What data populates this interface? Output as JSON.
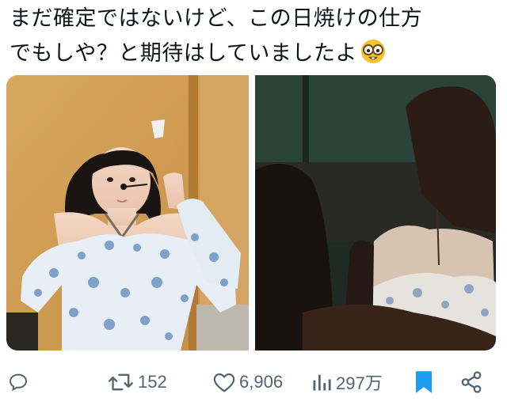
{
  "tweet": {
    "line1": "まだ確定ではないけど、この日焼けの仕方",
    "line2": "でもしや？と期待はしていましたよ",
    "emoji": "nerd-face-emoji"
  },
  "media": {
    "left_photo": "woman-in-blue-floral-dress-photo",
    "right_photo": "concert-crowd-photo"
  },
  "actions": {
    "reply_count": "",
    "retweet_count": "152",
    "like_count": "6,906",
    "view_count": "297万"
  },
  "colors": {
    "text": "#0f1419",
    "muted": "#536471",
    "accent": "#1d9bf0"
  }
}
